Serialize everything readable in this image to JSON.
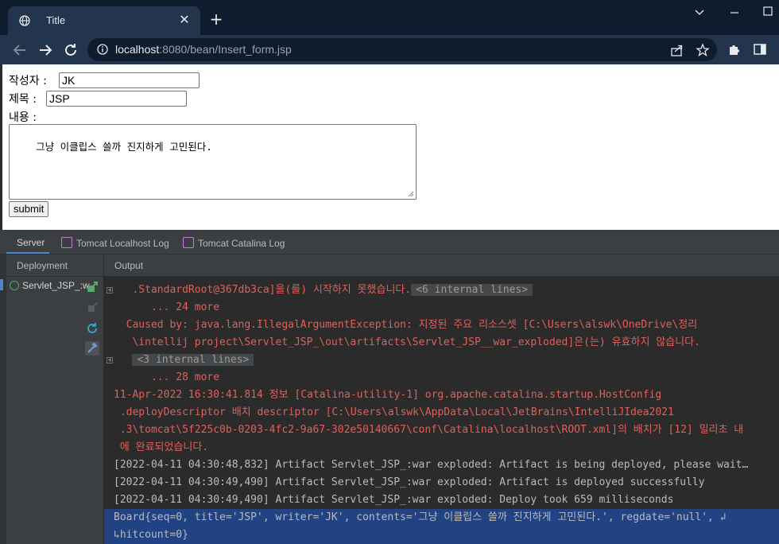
{
  "browser": {
    "tab_title": "Title",
    "url_host": "localhost",
    "url_rest": ":8080/bean/Insert_form.jsp",
    "icons": [
      "globe-icon",
      "close-icon",
      "plus-icon",
      "chevron-down-icon",
      "minimize-icon",
      "maximize-icon",
      "back-icon",
      "forward-icon",
      "reload-icon",
      "info-icon",
      "share-icon",
      "star-icon",
      "extension-icon",
      "sidepanel-icon"
    ]
  },
  "form": {
    "writer_label": "작성자 :",
    "writer_value": "JK",
    "title_label": "제목 :",
    "title_value": "JSP",
    "content_label": "내용 :",
    "content_value": "그냥 이클립스 쓸까 진지하게 고민된다.",
    "submit_label": "submit"
  },
  "ide": {
    "tabs": [
      "Server",
      "Tomcat Localhost Log",
      "Tomcat Catalina Log"
    ],
    "deployment_header": "Deployment",
    "output_header": "Output",
    "deployment_item": "Servlet_JSP_:w",
    "colors": {
      "accent": "#4a88c7",
      "error": "#e0605a",
      "selection": "#214283",
      "ok": "#59a869"
    }
  },
  "log": [
    {
      "text": "   .StandardRoot@367db3ca]을(를) 시작하지 못했습니다.",
      "tag": "<6 internal lines>",
      "style": "red",
      "gutter": true
    },
    {
      "text": "      ... 24 more",
      "style": "red"
    },
    {
      "text": "  Caused by: java.lang.IllegalArgumentException: 지정된 주요 리소스셋 [C:\\Users\\alswk\\OneDrive\\정리",
      "style": "red"
    },
    {
      "text": "   \\intellij project\\Servlet_JSP_\\out\\artifacts\\Servlet_JSP__war_exploded]은(는) 유효하지 않습니다.",
      "style": "red"
    },
    {
      "text": "   ",
      "tag": "<3 internal lines>",
      "style": "red",
      "gutter": true
    },
    {
      "text": "      ... 28 more",
      "style": "red"
    },
    {
      "text": "11-Apr-2022 16:30:41.814 정보 [Catalina-utility-1] org.apache.catalina.startup.HostConfig",
      "style": "red"
    },
    {
      "text": " .deployDescriptor 배치 descriptor [C:\\Users\\alswk\\AppData\\Local\\JetBrains\\IntelliJIdea2021",
      "style": "red"
    },
    {
      "text": " .3\\tomcat\\5f225c0b-0203-4fc2-9a67-302e50140667\\conf\\Catalina\\localhost\\ROOT.xml]의 배치가 [12] 밀리초 내",
      "style": "red"
    },
    {
      "text": " 에 완료되었습니다.",
      "style": "red"
    },
    {
      "text": "[2022-04-11 04:30:48,832] Artifact Servlet_JSP_:war exploded: Artifact is being deployed, please wait…",
      "style": "gray"
    },
    {
      "text": "[2022-04-11 04:30:49,490] Artifact Servlet_JSP_:war exploded: Artifact is deployed successfully",
      "style": "gray"
    },
    {
      "text": "[2022-04-11 04:30:49,490] Artifact Servlet_JSP_:war exploded: Deploy took 659 milliseconds",
      "style": "gray"
    },
    {
      "text": "Board{seq=0, title='JSP', writer='JK', contents='그냥 이클립스 쓸까 진지하게 고민된다.', regdate='null', ↲",
      "style": "gray",
      "highlight": true
    },
    {
      "text": "↳hitcount=0}",
      "style": "gray",
      "highlight": true
    }
  ]
}
